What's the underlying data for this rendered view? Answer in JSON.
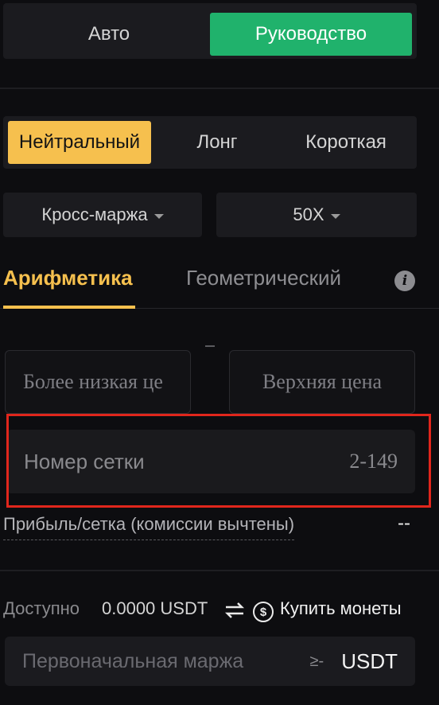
{
  "mode_tabs": {
    "auto": "Авто",
    "manual": "Руководство"
  },
  "direction": {
    "neutral": "Нейтральный",
    "long": "Лонг",
    "short": "Короткая"
  },
  "margin_mode": "Кросс-маржа",
  "leverage": "50X",
  "strategy_tabs": {
    "arithmetic": "Арифметика",
    "geometric": "Геометрический"
  },
  "info_glyph": "i",
  "price": {
    "lower_placeholder": "Более низкая це",
    "upper_placeholder": "Верхняя цена"
  },
  "grid": {
    "label": "Номер сетки",
    "range": "2-149"
  },
  "profit": {
    "label": "Прибыль/сетка (комиссии вычтены)",
    "value": "--"
  },
  "available": {
    "label": "Доступно",
    "value": "0.0000 USDT",
    "dollar_glyph": "$",
    "buy_label": "Купить монеты"
  },
  "margin_input": {
    "placeholder": "Первоначальная маржа",
    "ge": "≥-",
    "currency": "USDT"
  },
  "colors": {
    "accent_green": "#20b26c",
    "accent_yellow": "#f6c04e",
    "highlight_red": "#e0261c"
  }
}
